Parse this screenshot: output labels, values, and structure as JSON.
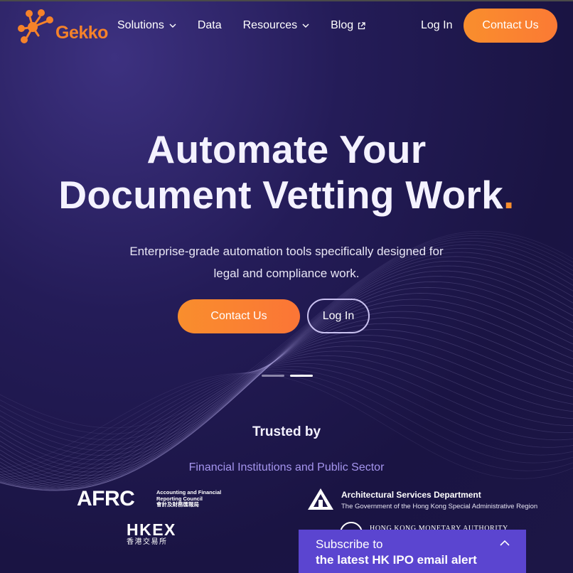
{
  "brand": {
    "name": "Gekko",
    "accent_color": "#f98e2d",
    "popup_color": "#5b45d0"
  },
  "nav": {
    "items": [
      {
        "label": "Solutions",
        "icon": "chevron-down-icon"
      },
      {
        "label": "Data",
        "icon": ""
      },
      {
        "label": "Resources",
        "icon": "chevron-down-icon"
      },
      {
        "label": "Blog",
        "icon": "external-link-icon"
      }
    ],
    "login_label": "Log In",
    "contact_label": "Contact Us"
  },
  "hero": {
    "title_line1": "Automate Your",
    "title_line2": "Document Vetting Work",
    "title_dot": ".",
    "subtitle_line1": "Enterprise-grade automation tools specifically designed for",
    "subtitle_line2": "legal and compliance work.",
    "contact_label": "Contact Us",
    "login_label": "Log In",
    "carousel": {
      "count": 2,
      "active": 1
    }
  },
  "trusted": {
    "heading": "Trusted by",
    "sector": "Financial Institutions and Public Sector",
    "logos": {
      "afrc": {
        "mark": "AFRC",
        "line1": "Accounting and Financial",
        "line2": "Reporting Council",
        "line3": "會計及財務匯報局"
      },
      "hkex": {
        "mark": "HKEX",
        "sub": "香港交易所"
      },
      "asd": {
        "name": "Architectural Services Department",
        "gov": "The Government of the Hong Kong Special Administrative Region"
      },
      "hkma": {
        "name": "HONG KONG MONETARY AUTHORITY"
      }
    }
  },
  "subscribe": {
    "line1": "Subscribe to",
    "line2": "the latest HK IPO email alert",
    "toggle_icon": "chevron-up-icon"
  }
}
